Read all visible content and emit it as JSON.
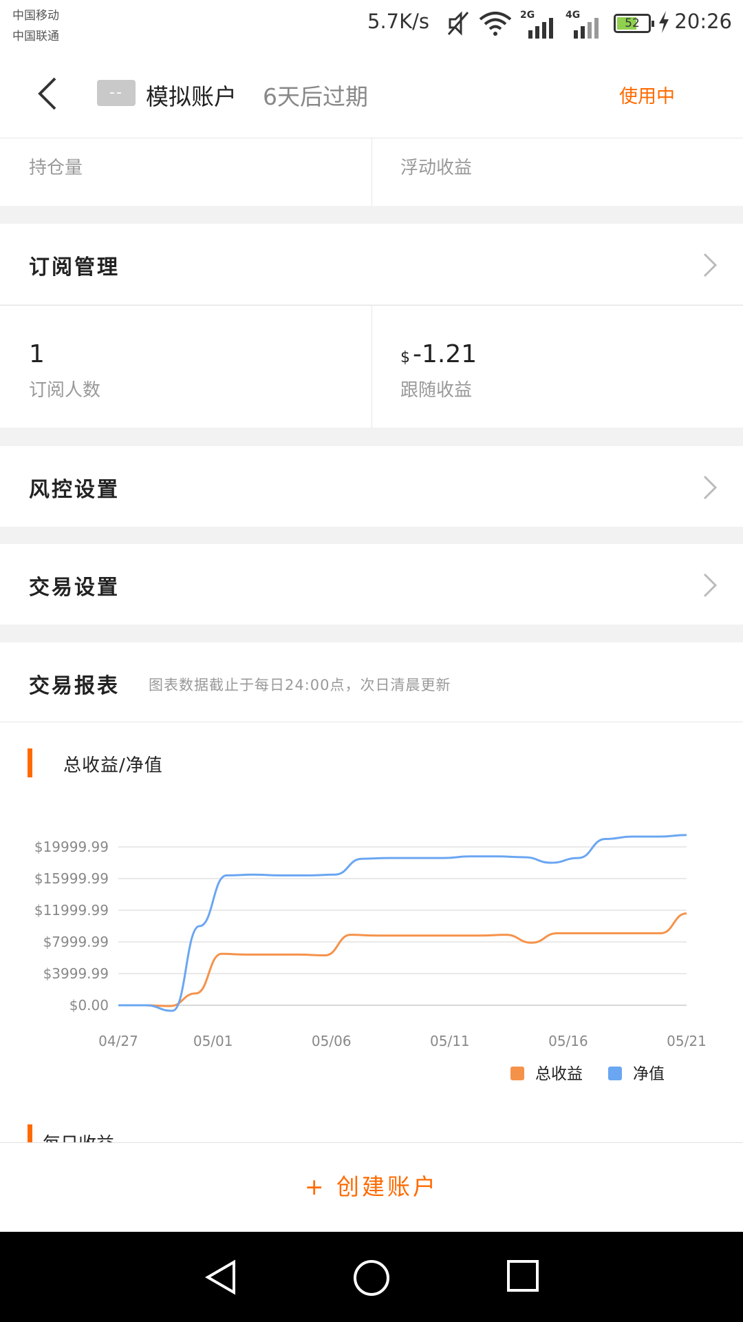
{
  "status_bar": {
    "carrier1": "中国移动",
    "carrier2": "中国联通",
    "net_speed": "5.7K/s",
    "battery": "52",
    "time": "20:26",
    "network_labels": [
      "2G",
      "4G"
    ]
  },
  "header": {
    "tag": "--",
    "account_name": "模拟账户",
    "expire": "6天后过期",
    "status": "使用中"
  },
  "stats_top": {
    "left_label": "持仓量",
    "right_label": "浮动收益"
  },
  "subscription": {
    "title": "订阅管理",
    "subscribers_value": "1",
    "subscribers_label": "订阅人数",
    "follow_currency": "$",
    "follow_value": "-1.21",
    "follow_label": "跟随收益"
  },
  "risk": {
    "title": "风控设置"
  },
  "trade": {
    "title": "交易设置"
  },
  "report": {
    "title": "交易报表",
    "note": "图表数据截止于每日24:00点，次日清晨更新"
  },
  "chart_title": "总收益/净值",
  "daily_title": "每日收益",
  "create_button": "+ 创建账户",
  "colors": {
    "accent": "#ff6a00",
    "total_profit": "#f5924a",
    "net_value": "#6aa6f2"
  },
  "chart_data": {
    "type": "line",
    "x": [
      "04/27",
      "04/28",
      "04/29",
      "04/30",
      "05/01",
      "05/02",
      "05/03",
      "05/04",
      "05/05",
      "05/06",
      "05/07",
      "05/08",
      "05/09",
      "05/10",
      "05/11",
      "05/12",
      "05/13",
      "05/14",
      "05/15",
      "05/16",
      "05/17",
      "05/18",
      "05/19",
      "05/20",
      "05/21"
    ],
    "x_ticks": [
      "04/27",
      "05/01",
      "05/06",
      "05/11",
      "05/16",
      "05/21"
    ],
    "y_ticks": [
      "$0.00",
      "$3999.99",
      "$7999.99",
      "$11999.99",
      "$15999.99",
      "$19999.99"
    ],
    "ylim": [
      0,
      19999.99
    ],
    "series": [
      {
        "name": "总收益",
        "values": [
          0,
          0,
          -100,
          1500,
          6500,
          6400,
          6400,
          6400,
          6300,
          8900,
          8800,
          8800,
          8800,
          8800,
          8800,
          8900,
          7900,
          9100,
          9100,
          9100,
          9100,
          9100,
          11600
        ]
      },
      {
        "name": "净值",
        "values": [
          0,
          0,
          -700,
          10000,
          16400,
          16500,
          16400,
          16400,
          16500,
          18500,
          18600,
          18600,
          18600,
          18800,
          18800,
          18700,
          18000,
          18600,
          21000,
          21300,
          21300,
          21500
        ]
      }
    ],
    "legend_position": "bottom-right",
    "grid": true
  }
}
